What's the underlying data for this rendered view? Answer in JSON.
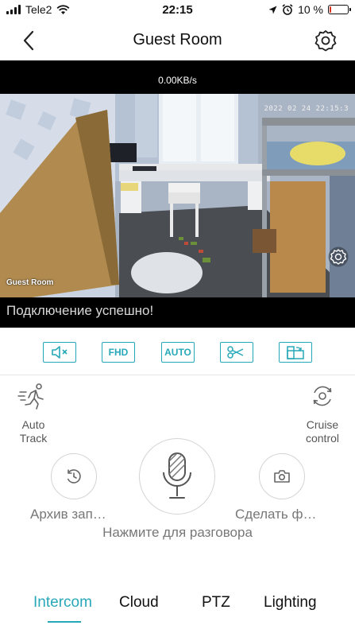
{
  "status_bar": {
    "carrier": "Tele2",
    "time": "22:15",
    "battery": "10 %",
    "battery_level": 0.1,
    "icons": [
      "signal-icon",
      "wifi-icon",
      "location-arrow-icon",
      "alarm-icon",
      "battery-icon"
    ]
  },
  "header": {
    "title": "Guest Room",
    "back_icon": "chevron-left-icon",
    "settings_icon": "gear-icon"
  },
  "video": {
    "bitrate": "0.00KB/s",
    "timestamp": "2022 02 24 22:15:3",
    "camera_label": "Guest Room",
    "connection_message": "Подключение успешно!",
    "settings_icon": "gear-icon"
  },
  "toolbar": {
    "mute_icon": "speaker-mute-icon",
    "quality_label": "FHD",
    "mode_label": "AUTO",
    "scissors_icon": "scissors-icon",
    "fullscreen_icon": "rotate-screen-icon"
  },
  "controls": {
    "auto_track_label_1": "Auto",
    "auto_track_label_2": "Track",
    "auto_track_icon": "running-person-icon",
    "cruise_label_1": "Cruise",
    "cruise_label_2": "control",
    "cruise_icon": "cruise-icon",
    "archive_label": "Архив зап…",
    "archive_icon": "history-icon",
    "snapshot_label": "Сделать ф…",
    "snapshot_icon": "camera-icon",
    "talk_hint": "Нажмите для разговора",
    "mic_icon": "microphone-icon"
  },
  "tabs": [
    {
      "label": "Intercom",
      "active": true
    },
    {
      "label": "Cloud",
      "active": false
    },
    {
      "label": "PTZ",
      "active": false
    },
    {
      "label": "Lighting",
      "active": false
    }
  ],
  "colors": {
    "accent": "#27a8b8",
    "battery_low": "#e0301e"
  }
}
